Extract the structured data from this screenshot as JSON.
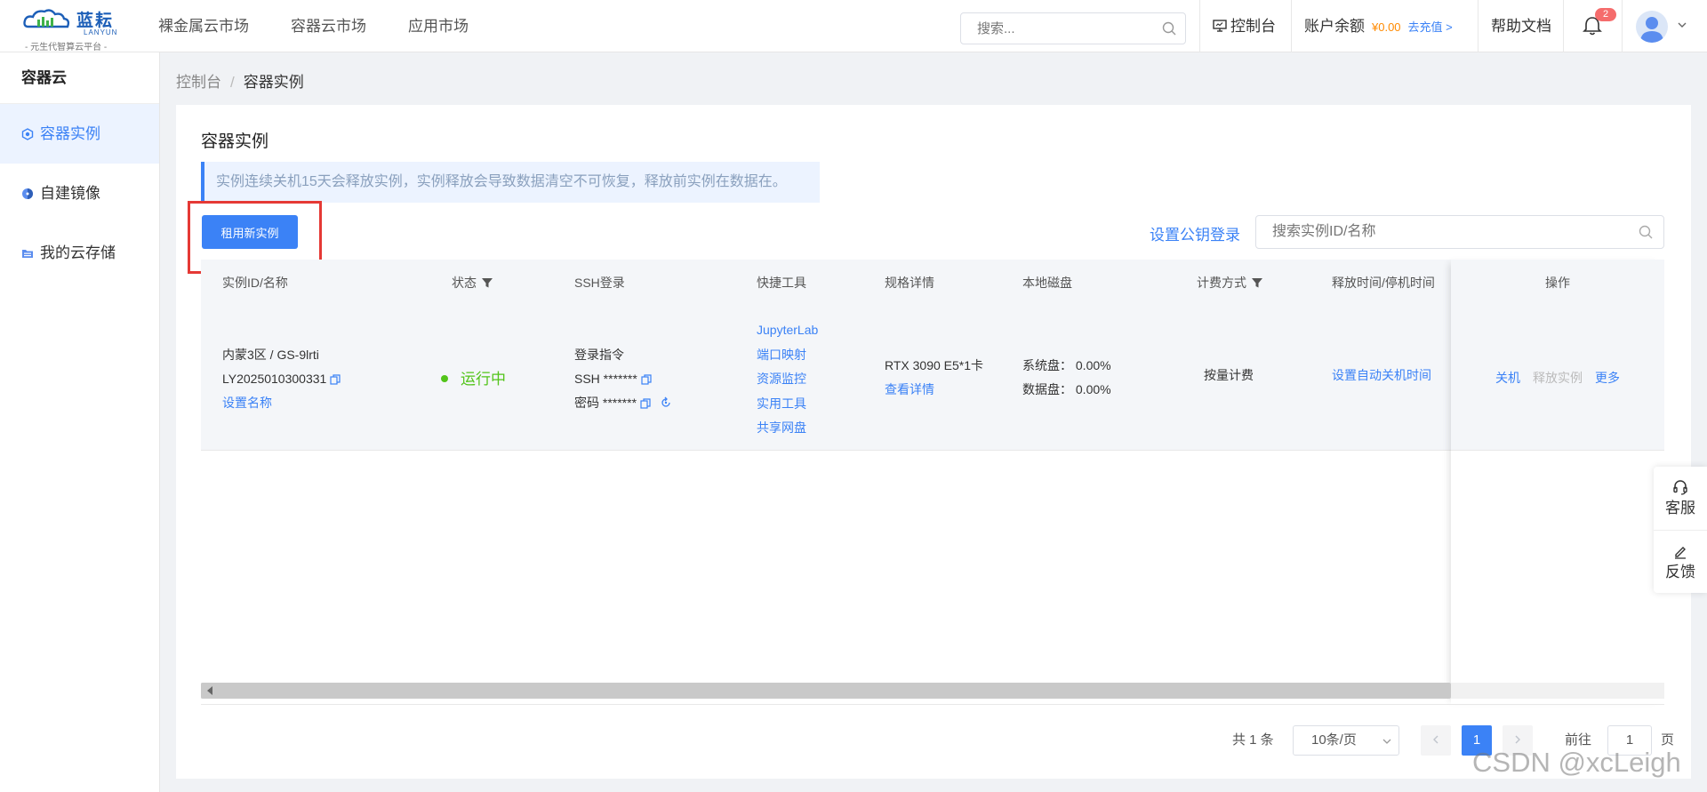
{
  "brand": {
    "name": "蓝耘",
    "name_en": "LANYUN",
    "slogan": "- 元生代智算云平台 -"
  },
  "topnav": [
    "裸金属云市场",
    "容器云市场",
    "应用市场"
  ],
  "topbar": {
    "search_placeholder": "搜索...",
    "console": "控制台",
    "balance_label": "账户余额",
    "balance_value": "¥0.00",
    "recharge": "去充值 >",
    "help": "帮助文档",
    "notification_count": "2"
  },
  "sidebar": {
    "title": "容器云",
    "items": [
      {
        "label": "容器实例",
        "active": true
      },
      {
        "label": "自建镜像",
        "active": false
      },
      {
        "label": "我的云存储",
        "active": false
      }
    ]
  },
  "breadcrumb": {
    "root": "控制台",
    "separator": "/",
    "current": "容器实例"
  },
  "page": {
    "title": "容器实例",
    "notice": "实例连续关机15天会释放实例，实例释放会导致数据清空不可恢复，释放前实例在数据在。",
    "create_button": "租用新实例",
    "pubkey_link": "设置公钥登录",
    "search_placeholder": "搜索实例ID/名称"
  },
  "table": {
    "columns": [
      "实例ID/名称",
      "状态",
      "SSH登录",
      "快捷工具",
      "规格详情",
      "本地磁盘",
      "计费方式",
      "释放时间/停机时间",
      "操作"
    ],
    "row": {
      "region_name": "内蒙3区 / GS-9lrti",
      "instance_id": "LY2025010300331",
      "set_name": "设置名称",
      "status": "运行中",
      "ssh_title": "登录指令",
      "ssh_cmd": "SSH *******",
      "ssh_pwd": "密码 *******",
      "tools": [
        "JupyterLab",
        "端口映射",
        "资源监控",
        "实用工具",
        "共享网盘"
      ],
      "spec": "RTX 3090 E5*1卡",
      "spec_link": "查看详情",
      "sys_disk": "系统盘：  0.00%",
      "data_disk": "数据盘：  0.00%",
      "billing": "按量计费",
      "release_link": "设置自动关机时间",
      "actions": {
        "shutdown": "关机",
        "release": "释放实例",
        "more": "更多"
      }
    }
  },
  "pagination": {
    "total": "共 1 条",
    "page_size": "10条/页",
    "current_page": "1",
    "goto_label": "前往",
    "goto_value": "1",
    "goto_unit": "页"
  },
  "float_bar": {
    "service": "客服",
    "feedback": "反馈"
  },
  "watermark": "CSDN @xcLeigh",
  "colors": {
    "primary": "#3b82f6",
    "running": "#52c41a",
    "balance": "#ff8a00",
    "highlight": "#e53935",
    "badge": "#f56c6c"
  }
}
